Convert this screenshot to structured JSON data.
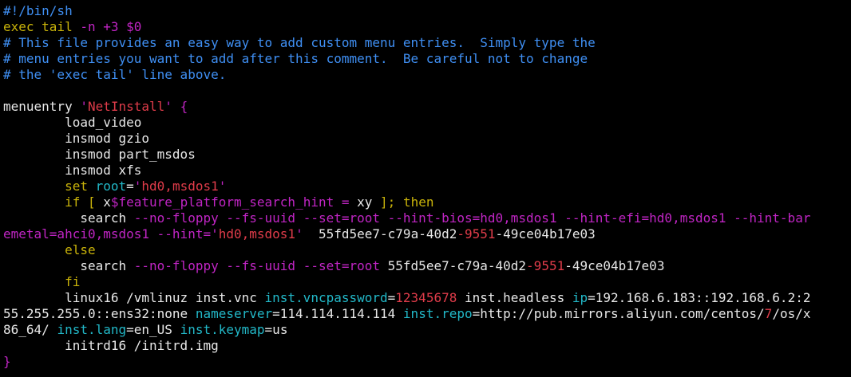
{
  "colors": {
    "background": "#000000",
    "text": "#e8e8e8",
    "comment": "#3f8ff3",
    "keyword": "#c9b30a",
    "option": "#c025c4",
    "string": "#e03c4a",
    "variable": "#22b8c8"
  },
  "editor": {
    "lines": [
      [
        {
          "t": "#!/bin/sh",
          "c": "comment"
        }
      ],
      [
        {
          "t": "exec tail ",
          "c": "keyword"
        },
        {
          "t": "-n +3 $0",
          "c": "option"
        }
      ],
      [
        {
          "t": "# This file provides an easy way to add custom menu entries.  Simply type the",
          "c": "comment"
        }
      ],
      [
        {
          "t": "# menu entries you want to add after this comment.  Be careful not to change",
          "c": "comment"
        }
      ],
      [
        {
          "t": "# the 'exec tail' line above.",
          "c": "comment"
        }
      ],
      [
        {
          "t": "",
          "c": "text"
        }
      ],
      [
        {
          "t": "menuentry ",
          "c": "text"
        },
        {
          "t": "'",
          "c": "option"
        },
        {
          "t": "NetInstall",
          "c": "string"
        },
        {
          "t": "' {",
          "c": "option"
        }
      ],
      [
        {
          "t": "        load_video",
          "c": "text"
        }
      ],
      [
        {
          "t": "        insmod gzio",
          "c": "text"
        }
      ],
      [
        {
          "t": "        insmod part_msdos",
          "c": "text"
        }
      ],
      [
        {
          "t": "        insmod xfs",
          "c": "text"
        }
      ],
      [
        {
          "t": "        ",
          "c": "text"
        },
        {
          "t": "set ",
          "c": "keyword"
        },
        {
          "t": "root",
          "c": "var"
        },
        {
          "t": "=",
          "c": "text"
        },
        {
          "t": "'",
          "c": "option"
        },
        {
          "t": "hd0,msdos1",
          "c": "string"
        },
        {
          "t": "'",
          "c": "option"
        }
      ],
      [
        {
          "t": "        ",
          "c": "text"
        },
        {
          "t": "if [ ",
          "c": "keyword"
        },
        {
          "t": "x",
          "c": "text"
        },
        {
          "t": "$feature_platform_search_hint",
          "c": "option"
        },
        {
          "t": " = ",
          "c": "option"
        },
        {
          "t": "xy",
          "c": "text"
        },
        {
          "t": " ]; then",
          "c": "keyword"
        }
      ],
      [
        {
          "t": "          search ",
          "c": "text"
        },
        {
          "t": "--no-floppy --fs-uuid --set=root --hint-bios=hd0,msdos1 --hint-efi=hd0,msdos1 --hint-bar",
          "c": "option"
        }
      ],
      [
        {
          "t": "emetal=ahci0,msdos1 --hint=",
          "c": "option"
        },
        {
          "t": "'",
          "c": "option"
        },
        {
          "t": "hd0,msdos1",
          "c": "string"
        },
        {
          "t": "'",
          "c": "option"
        },
        {
          "t": "  55fd5ee7-c79a-40d2",
          "c": "text"
        },
        {
          "t": "-9551",
          "c": "string"
        },
        {
          "t": "-49ce04b17e03",
          "c": "text"
        }
      ],
      [
        {
          "t": "        else",
          "c": "keyword"
        }
      ],
      [
        {
          "t": "          search ",
          "c": "text"
        },
        {
          "t": "--no-floppy --fs-uuid --set=root",
          "c": "option"
        },
        {
          "t": " 55fd5ee7-c79a-40d2",
          "c": "text"
        },
        {
          "t": "-9551",
          "c": "string"
        },
        {
          "t": "-49ce04b17e03",
          "c": "text"
        }
      ],
      [
        {
          "t": "        fi",
          "c": "keyword"
        }
      ],
      [
        {
          "t": "        linux16 /vmlinuz inst.vnc ",
          "c": "text"
        },
        {
          "t": "inst.vncpassword",
          "c": "var"
        },
        {
          "t": "=",
          "c": "text"
        },
        {
          "t": "12345678",
          "c": "string"
        },
        {
          "t": " inst.headless ",
          "c": "text"
        },
        {
          "t": "ip",
          "c": "var"
        },
        {
          "t": "=192.168.6.183::192.168.6.2:2",
          "c": "text"
        }
      ],
      [
        {
          "t": "55.255.255.0::ens32:none ",
          "c": "text"
        },
        {
          "t": "nameserver",
          "c": "var"
        },
        {
          "t": "=114.114.114.114 ",
          "c": "text"
        },
        {
          "t": "inst.repo",
          "c": "var"
        },
        {
          "t": "=http://pub.mirrors.aliyun.com/centos/",
          "c": "text"
        },
        {
          "t": "7",
          "c": "string"
        },
        {
          "t": "/os/x",
          "c": "text"
        }
      ],
      [
        {
          "t": "86_64/ ",
          "c": "text"
        },
        {
          "t": "inst.lang",
          "c": "var"
        },
        {
          "t": "=en_US ",
          "c": "text"
        },
        {
          "t": "inst.keymap",
          "c": "var"
        },
        {
          "t": "=us",
          "c": "text"
        }
      ],
      [
        {
          "t": "        initrd16 /initrd.img",
          "c": "text"
        }
      ],
      [
        {
          "t": "}",
          "c": "option"
        }
      ]
    ]
  }
}
